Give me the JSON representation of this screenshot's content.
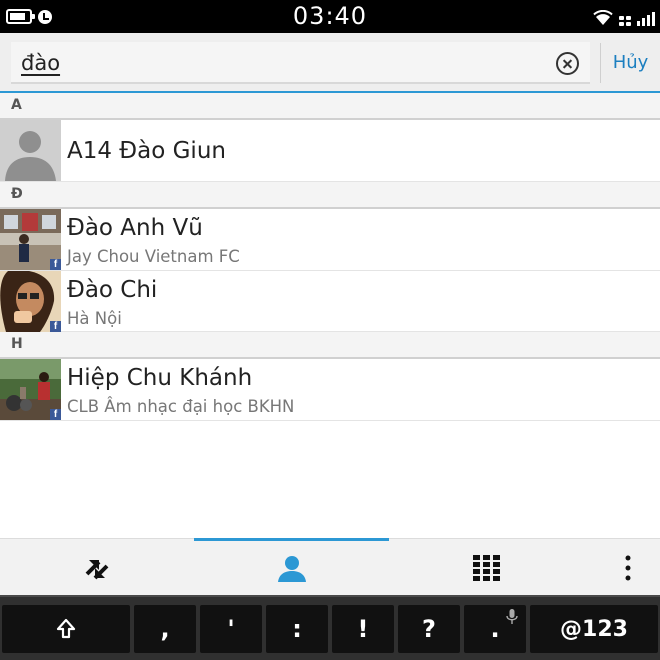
{
  "status_bar": {
    "time": "03:40",
    "battery_level": 0.85
  },
  "search": {
    "query": "đào",
    "cancel_label": "Hủy"
  },
  "sections": [
    {
      "letter": "A",
      "contacts": [
        {
          "name": "A14 Đào Giun",
          "subtitle": "",
          "avatar": "default-silhouette",
          "facebook": false
        }
      ]
    },
    {
      "letter": "Đ",
      "contacts": [
        {
          "name": "Đào Anh Vũ",
          "subtitle": "Jay Chou Vietnam FC",
          "avatar": "photo",
          "facebook": true
        },
        {
          "name": "Đào Chi",
          "subtitle": "Hà Nội",
          "avatar": "photo",
          "facebook": true
        }
      ]
    },
    {
      "letter": "H",
      "contacts": [
        {
          "name": "Hiệp Chu Khánh",
          "subtitle": "CLB Âm nhạc đại học BKHN",
          "avatar": "photo",
          "facebook": true
        }
      ]
    }
  ],
  "tabs": [
    {
      "icon": "call-log-icon",
      "selected": false
    },
    {
      "icon": "contacts-icon",
      "selected": true
    },
    {
      "icon": "dialpad-icon",
      "selected": false
    },
    {
      "icon": "overflow-menu-icon",
      "selected": false
    }
  ],
  "keyboard": {
    "keys": [
      ",",
      "'",
      ":",
      "!",
      "?",
      "."
    ],
    "symbol_key": "@123"
  },
  "colors": {
    "accent": "#2c98d4",
    "cancel_text": "#1c7fc0",
    "facebook": "#3b5998"
  }
}
